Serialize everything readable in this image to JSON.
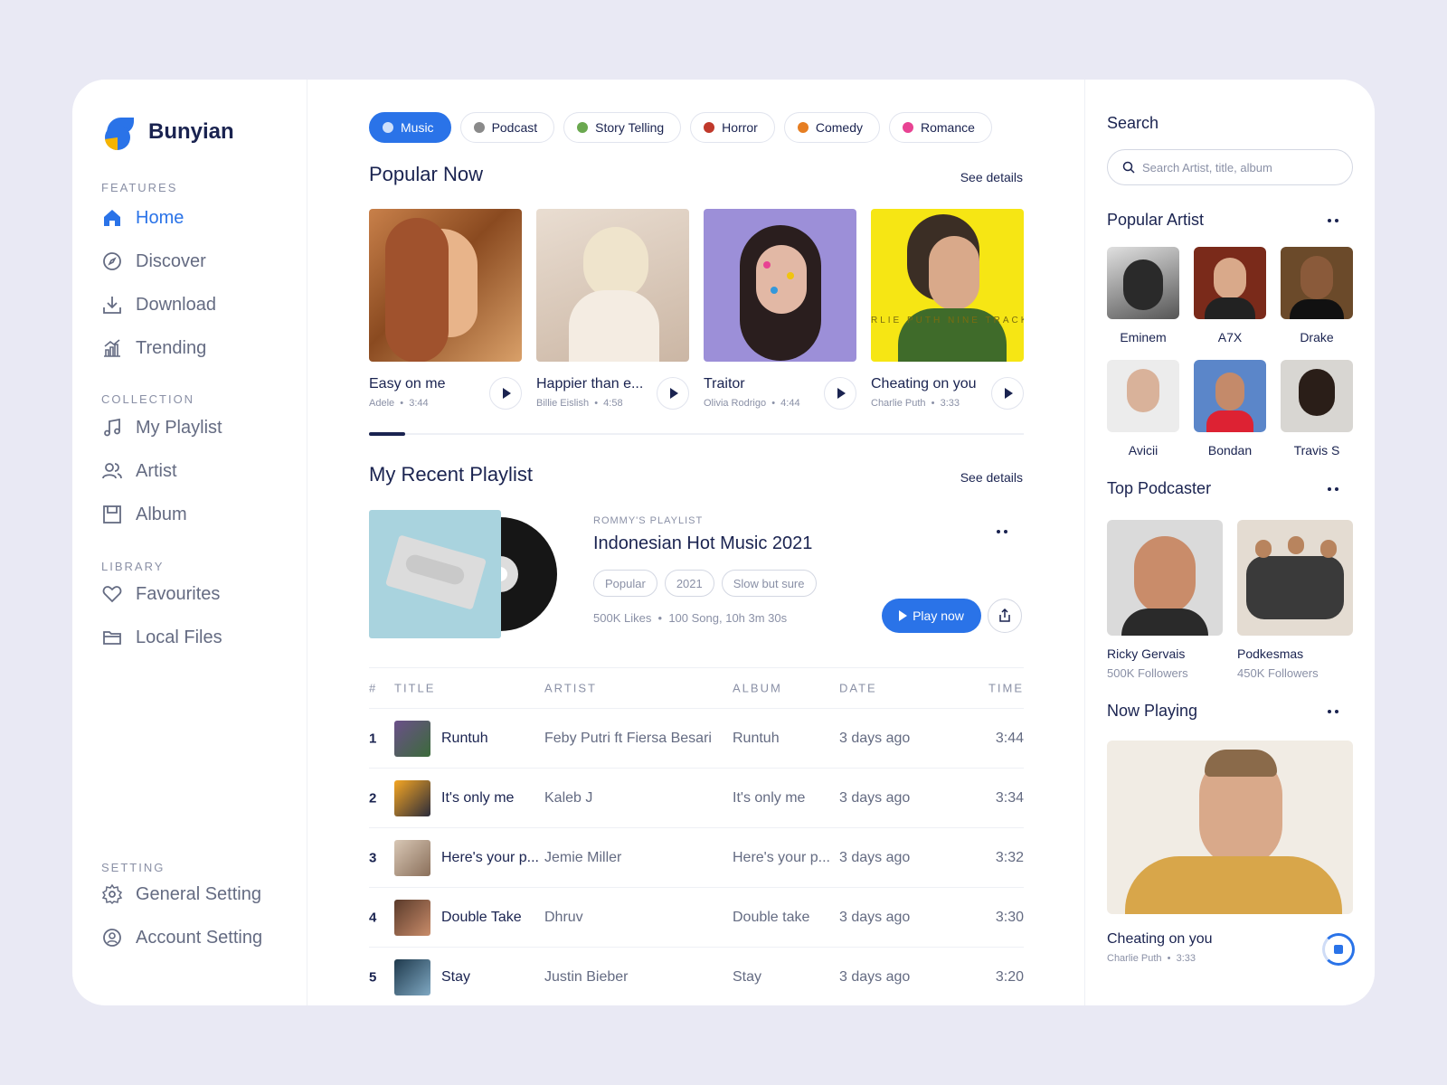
{
  "brand": {
    "name": "Bunyian"
  },
  "sidebar": {
    "features_title": "FEATURES",
    "features": [
      {
        "label": "Home",
        "icon": "home-icon",
        "active": true
      },
      {
        "label": "Discover",
        "icon": "compass-icon"
      },
      {
        "label": "Download",
        "icon": "download-icon"
      },
      {
        "label": "Trending",
        "icon": "chart-icon"
      }
    ],
    "collection_title": "COLLECTION",
    "collection": [
      {
        "label": "My Playlist",
        "icon": "music-note-icon"
      },
      {
        "label": "Artist",
        "icon": "users-icon"
      },
      {
        "label": "Album",
        "icon": "album-icon"
      }
    ],
    "library_title": "LIBRARY",
    "library": [
      {
        "label": "Favourites",
        "icon": "heart-icon"
      },
      {
        "label": "Local Files",
        "icon": "folder-icon"
      }
    ],
    "setting_title": "SETTING",
    "settings": [
      {
        "label": "General Setting",
        "icon": "gear-icon"
      },
      {
        "label": "Account Setting",
        "icon": "user-gear-icon"
      }
    ]
  },
  "categories": [
    {
      "label": "Music",
      "active": true,
      "icon": "disc-icon"
    },
    {
      "label": "Podcast",
      "icon": "microphone-icon"
    },
    {
      "label": "Story Telling",
      "icon": "books-icon"
    },
    {
      "label": "Horror",
      "icon": "ghost-icon"
    },
    {
      "label": "Comedy",
      "icon": "clown-icon"
    },
    {
      "label": "Romance",
      "icon": "hearts-icon"
    }
  ],
  "popular": {
    "title": "Popular Now",
    "see_details": "See details",
    "items": [
      {
        "title": "Easy on me",
        "artist": "Adele",
        "duration": "3:44"
      },
      {
        "title": "Happier than e...",
        "artist": "Billie Eislish",
        "duration": "4:58"
      },
      {
        "title": "Traitor",
        "artist": "Olivia Rodrigo",
        "duration": "4:44"
      },
      {
        "title": "Cheating on you",
        "artist": "Charlie Puth",
        "duration": "3:33"
      }
    ],
    "cover4_text": "RLIE PUTH NINE TRACK"
  },
  "recent": {
    "title": "My Recent Playlist",
    "see_details": "See details",
    "owner": "ROMMY'S PLAYLIST",
    "name": "Indonesian Hot Music 2021",
    "tags": [
      "Popular",
      "2021",
      "Slow but sure"
    ],
    "likes": "500K Likes",
    "songs": "100 Song, 10h 3m 30s",
    "play_label": "Play now"
  },
  "table": {
    "headers": {
      "num": "#",
      "title": "TITLE",
      "artist": "ARTIST",
      "album": "ALBUM",
      "date": "DATE",
      "time": "TIME"
    },
    "rows": [
      {
        "num": "1",
        "title": "Runtuh",
        "artist": "Feby Putri ft Fiersa Besari",
        "album": "Runtuh",
        "date": "3 days ago",
        "time": "3:44"
      },
      {
        "num": "2",
        "title": "It's only me",
        "artist": "Kaleb J",
        "album": "It's only me",
        "date": "3 days ago",
        "time": "3:34"
      },
      {
        "num": "3",
        "title": "Here's your p...",
        "artist": "Jemie Miller",
        "album": "Here's your p...",
        "date": "3 days ago",
        "time": "3:32"
      },
      {
        "num": "4",
        "title": "Double Take",
        "artist": "Dhruv",
        "album": "Double take",
        "date": "3 days ago",
        "time": "3:30"
      },
      {
        "num": "5",
        "title": "Stay",
        "artist": "Justin Bieber",
        "album": "Stay",
        "date": "3 days ago",
        "time": "3:20"
      }
    ]
  },
  "right": {
    "search_title": "Search",
    "search_placeholder": "Search Artist, title, album",
    "artists_title": "Popular Artist",
    "artists": [
      "Eminem",
      "A7X",
      "Drake",
      "Avicii",
      "Bondan",
      "Travis S"
    ],
    "podcaster_title": "Top Podcaster",
    "podcasters": [
      {
        "name": "Ricky Gervais",
        "followers": "500K Followers"
      },
      {
        "name": "Podkesmas",
        "followers": "450K Followers"
      }
    ],
    "now_playing_title": "Now Playing",
    "now_playing": {
      "title": "Cheating on you",
      "artist": "Charlie Puth",
      "duration": "3:33"
    }
  },
  "colors": {
    "accent": "#2a73e8",
    "text": "#1a2350",
    "muted": "#8a90a6"
  }
}
